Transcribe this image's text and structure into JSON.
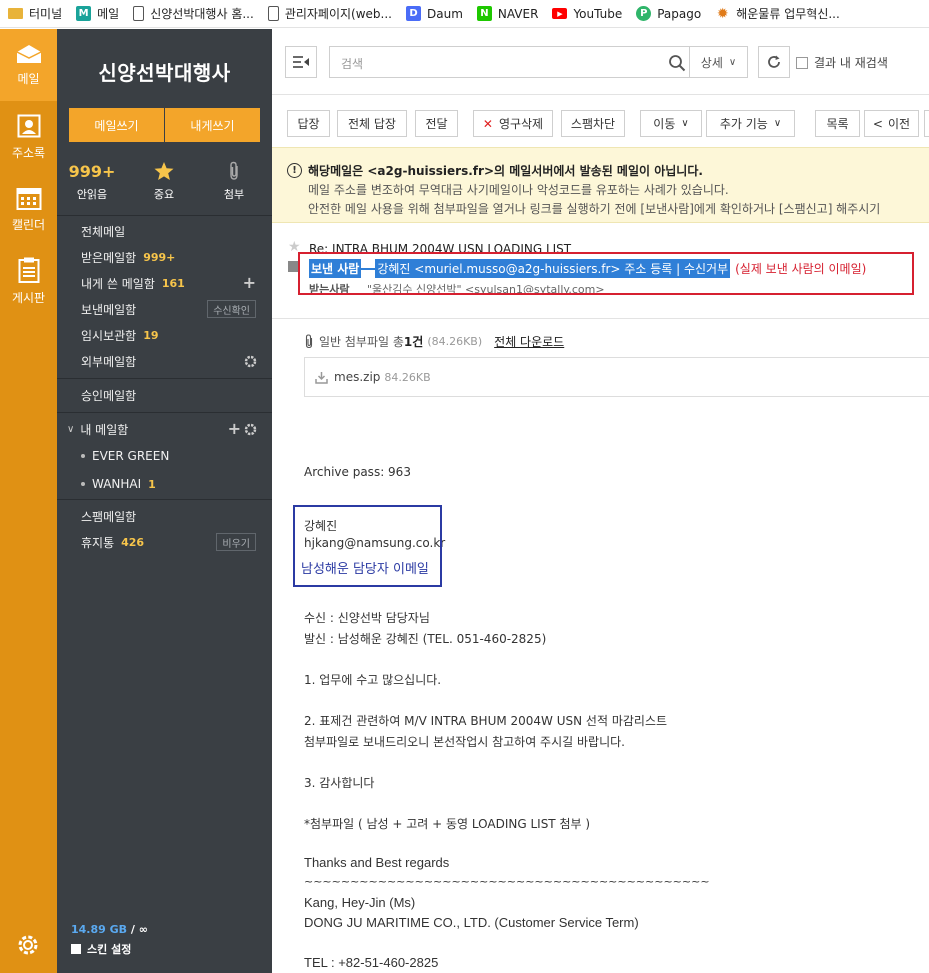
{
  "bookmarks": [
    {
      "label": "터미널",
      "icon": "folder-icon",
      "color": "#e8b33a"
    },
    {
      "label": "메일",
      "icon": "mail-m-icon",
      "color": "#1aa39a"
    },
    {
      "label": "신양선박대행사 홈...",
      "icon": "page-icon",
      "color": "#666666"
    },
    {
      "label": "관리자페이지(web...",
      "icon": "page-icon",
      "color": "#666666"
    },
    {
      "label": "Daum",
      "icon": "daum-icon",
      "color": "#4a6cf7"
    },
    {
      "label": "NAVER",
      "icon": "naver-icon",
      "color": "#1ec800"
    },
    {
      "label": "YouTube",
      "icon": "youtube-icon",
      "color": "#ff0000"
    },
    {
      "label": "Papago",
      "icon": "papago-icon",
      "color": "#2fb56a"
    },
    {
      "label": "해운물류 업무혁신...",
      "icon": "sun-icon",
      "color": "#e07b1a"
    }
  ],
  "rail": {
    "mail": "메일",
    "contacts": "주소록",
    "calendar": "캘린더",
    "board": "게시판"
  },
  "sidebar": {
    "brand": "신양선박대행사",
    "compose": "메일쓰기",
    "compose_self": "내게쓰기",
    "stats": [
      {
        "value": "999+",
        "label": "안읽음"
      },
      {
        "value": "",
        "label": "중요"
      },
      {
        "value": "",
        "label": "첨부"
      }
    ],
    "folders": [
      {
        "label": "전체메일",
        "count": ""
      },
      {
        "label": "받은메일함",
        "count": "999+"
      },
      {
        "label": "내게 쓴 메일함",
        "count": "161"
      },
      {
        "label": "보낸메일함",
        "count": ""
      },
      {
        "label": "임시보관함",
        "count": "19"
      },
      {
        "label": "외부메일함",
        "count": ""
      }
    ],
    "receipt_btn": "수신확인",
    "approval": "승인메일함",
    "my_mailbox": "내 메일함",
    "sub_folders": [
      {
        "label": "EVER GREEN",
        "count": ""
      },
      {
        "label": "WANHAI",
        "count": "1"
      }
    ],
    "spam": "스팸메일함",
    "trash": "휴지통",
    "trash_count": "426",
    "empty_btn": "비우기",
    "storage_gb": "14.89 GB",
    "storage_rest": " / ∞",
    "skin": "스킨 설정"
  },
  "search": {
    "placeholder": "검색",
    "detail": "상세",
    "within": "결과 내 재검색"
  },
  "toolbar": {
    "reply": "답장",
    "reply_all": "전체 답장",
    "forward": "전달",
    "delete": "영구삭제",
    "block": "스팸차단",
    "move": "이동",
    "more": "추가 기능",
    "list": "목록",
    "prev": "이전"
  },
  "warning": {
    "line1": "해당메일은 <a2g-huissiers.fr>의 메일서버에서 발송된 메일이 아닙니다.",
    "line2": "메일 주소를 변조하여 무역대금 사기메일이나 악성코드를 유포하는 사례가 있습니다.",
    "line3": "안전한 메일 사용을 위해 첨부파일을 열거나 링크를 실행하기 전에 [보낸사람]에게 확인하거나 [스팸신고] 해주시기"
  },
  "header": {
    "subject": "Re: INTRA BHUM 2004W USN LOADING LIST",
    "from_label": "보낸 사람",
    "from_value": "강혜진 <muriel.musso@a2g-huissiers.fr> 주소 등록 | 수신거부",
    "from_note": "(실제 보낸 사람의 이메일)",
    "to_label": "받는사람",
    "to_value": "\"울산김수 신양선박\" <syulsan1@sytally.com>"
  },
  "attachment": {
    "summary_prefix": "일반 첨부파일 총 ",
    "summary_count": "1건",
    "summary_size": "(84.26KB)",
    "download_all": "전체 다운로드",
    "file_name": "mes.zip",
    "file_size": "84.26KB"
  },
  "body": {
    "archive": "Archive pass: 963",
    "sig_name": "강혜진",
    "sig_email": "hjkang@namsung.co.kr",
    "sig_note": "남성해운 담당자 이메일",
    "to_line": "수신 : 신양선박 담당자님",
    "from_line": "발신 : 남성해운 강혜진 (TEL.  051-460-2825)",
    "p1": "1. 업무에 수고 많으십니다.",
    "p2a": "2. 표제건  관련하여 M/V INTRA BHUM 2004W USN 선적 마감리스트",
    "p2b": "첨부파일로 보내드리오니 본선작업시 참고하여 주시길  바랍니다.",
    "p3": "3. 감사합니다",
    "p4": "*첨부파일 ( 남성 + 고려 + 동영  LOADING LIST 첨부 )",
    "thanks": "Thanks and Best regards",
    "tilde": "~~~~~~~~~~~~~~~~~~~~~~~~~~~~~~~~~~~~~~~~~~~~",
    "name": "Kang, Hey-Jin (Ms)",
    "company": "DONG JU MARITIME CO.,  LTD. (Customer Service Term)",
    "tel": "TEL : +82-51-460-2825"
  }
}
